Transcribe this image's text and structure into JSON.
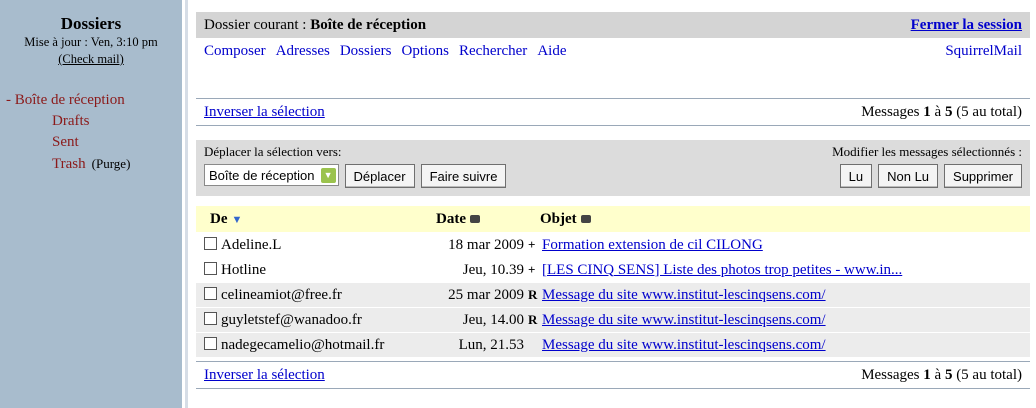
{
  "sidebar": {
    "title": "Dossiers",
    "updated": "Mise à jour : Ven, 3:10 pm",
    "check_mail": "(Check mail)",
    "folders": [
      {
        "prefix": "- ",
        "label": "Boîte de réception"
      },
      {
        "label": "Drafts"
      },
      {
        "label": "Sent"
      },
      {
        "label": "Trash",
        "extra": "(Purge)"
      }
    ]
  },
  "topbar": {
    "current_folder_label": "Dossier courant : ",
    "current_folder": "Boîte de réception",
    "logout": "Fermer la session"
  },
  "menu": {
    "items": [
      "Composer",
      "Adresses",
      "Dossiers",
      "Options",
      "Rechercher",
      "Aide"
    ],
    "brand": "SquirrelMail"
  },
  "selection": {
    "invert": "Inverser la sélection",
    "count_prefix": "Messages ",
    "count_from": "1",
    "count_mid": " à ",
    "count_to": "5",
    "count_suffix": " (5 au total)"
  },
  "actions": {
    "move_label": "Déplacer la sélection vers:",
    "move_target": "Boîte de réception",
    "move_button": "Déplacer",
    "forward_button": "Faire suivre",
    "modify_label": "Modifier les messages sélectionnés :",
    "read_button": "Lu",
    "unread_button": "Non Lu",
    "delete_button": "Supprimer"
  },
  "table": {
    "headers": {
      "from": "De",
      "date": "Date",
      "subject": "Objet"
    },
    "rows": [
      {
        "from": "Adeline.L",
        "date": "18 mar 2009",
        "flag": "+",
        "subject": "Formation extension de cil CILONG"
      },
      {
        "from": "Hotline",
        "date": "Jeu, 10.39",
        "flag": "+",
        "subject": "[LES CINQ SENS] Liste des photos trop petites - www.in..."
      },
      {
        "from": "celineamiot@free.fr",
        "date": "25 mar 2009",
        "flag": "R",
        "subject": "Message du site www.institut-lescinqsens.com/"
      },
      {
        "from": "guyletstef@wanadoo.fr",
        "date": "Jeu, 14.00",
        "flag": "R",
        "subject": "Message du site www.institut-lescinqsens.com/"
      },
      {
        "from": "nadegecamelio@hotmail.fr",
        "date": "Lun, 21.53",
        "flag": "",
        "subject": "Message du site www.institut-lescinqsens.com/"
      }
    ]
  },
  "colors": {
    "sidebar": "#a8bccd",
    "folder": "#8b1a1a",
    "link": "#0000cc",
    "header_row": "#ffffcc"
  }
}
